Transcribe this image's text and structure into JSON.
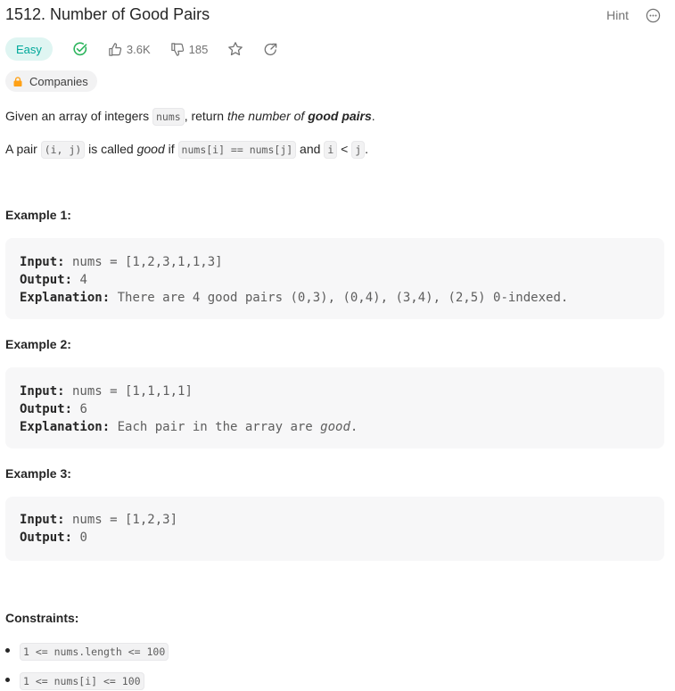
{
  "problem": {
    "title": "1512. Number of Good Pairs",
    "hint_label": "Hint",
    "difficulty": "Easy",
    "likes": "3.6K",
    "dislikes": "185",
    "companies_label": "Companies"
  },
  "description": {
    "p1": {
      "t1": "Given an array of integers ",
      "code1": "nums",
      "t2": ", return ",
      "em1": "the number of ",
      "strong1": "good pairs",
      "t3": "."
    },
    "p2": {
      "t1": "A pair ",
      "code1": "(i, j)",
      "t2": " is called ",
      "em1": "good",
      "t3": " if ",
      "code2": "nums[i] == nums[j]",
      "t4": " and ",
      "code3": "i",
      "t5": " < ",
      "code4": "j",
      "t6": "."
    }
  },
  "examples": [
    {
      "heading": "Example 1:",
      "input_label": "Input:",
      "input_value": " nums = [1,2,3,1,1,3]",
      "output_label": "Output:",
      "output_value": " 4",
      "explanation_label": "Explanation:",
      "explanation_value": " There are 4 good pairs (0,3), (0,4), (3,4), (2,5) 0-indexed."
    },
    {
      "heading": "Example 2:",
      "input_label": "Input:",
      "input_value": " nums = [1,1,1,1]",
      "output_label": "Output:",
      "output_value": " 6",
      "explanation_label": "Explanation:",
      "explanation_value": " Each pair in the array are ",
      "explanation_em": "good",
      "explanation_end": "."
    },
    {
      "heading": "Example 3:",
      "input_label": "Input:",
      "input_value": " nums = [1,2,3]",
      "output_label": "Output:",
      "output_value": " 0"
    }
  ],
  "constraints": {
    "heading": "Constraints:",
    "items": [
      "1 <= nums.length <= 100",
      "1 <= nums[i] <= 100"
    ]
  },
  "colors": {
    "easy_text": "#00a89a",
    "easy_bg": "#dff5f2",
    "solved_check": "#2db55d",
    "lock": "#ffa116"
  }
}
